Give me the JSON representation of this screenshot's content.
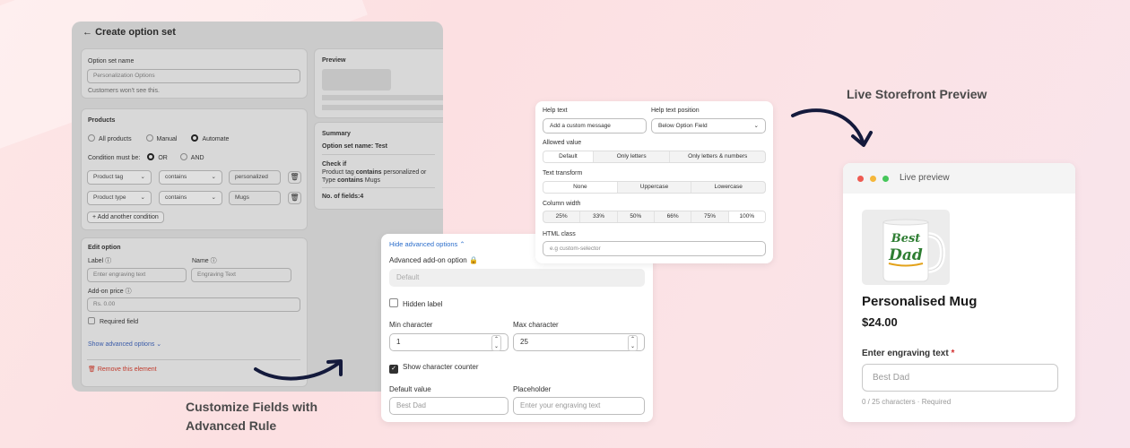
{
  "colors": {
    "accent_link": "#2c6ecb",
    "danger": "#c0392b",
    "heading": "#4a4a4a",
    "arrow": "#141a3c"
  },
  "admin": {
    "title": "Create option set",
    "option_set_name_label": "Option set name",
    "option_set_name_value": "Personalization Options",
    "option_set_name_help": "Customers won't see this.",
    "products": {
      "heading": "Products",
      "scope": [
        "All products",
        "Manual",
        "Automate"
      ],
      "condition_label": "Condition must be:",
      "condition_or": "OR",
      "condition_and": "AND",
      "rules": [
        {
          "field": "Product tag",
          "op": "contains",
          "value": "personalized"
        },
        {
          "field": "Product type",
          "op": "contains",
          "value": "Mugs"
        }
      ],
      "add_condition": "Add another condition"
    },
    "edit_option": {
      "heading": "Edit option",
      "label_label": "Label",
      "name_label": "Name",
      "label_placeholder": "Enter engraving text",
      "name_placeholder": "Engraving Text",
      "price_label": "Add-on price",
      "price_placeholder": "Rs. 0.00",
      "required_label": "Required field",
      "show_advanced": "Show advanced options",
      "remove": "Remove this element"
    },
    "preview_heading": "Preview",
    "summary": {
      "heading": "Summary",
      "name_label": "Option set name:",
      "name_value": "Test",
      "check_if": "Check if",
      "cond1_a": "Product tag",
      "cond1_b": "contains",
      "cond1_c": "personalized or",
      "cond2_a": "Type",
      "cond2_b": "contains",
      "cond2_c": "Mugs",
      "fields": "No. of fields:4"
    }
  },
  "advanced": {
    "hide_link": "Hide advanced options",
    "addon_label": "Advanced add-on option",
    "addon_value": "Default",
    "hidden_label": "Hidden label",
    "min_label": "Min character",
    "max_label": "Max character",
    "min_value": "1",
    "max_value": "25",
    "show_counter": "Show character counter",
    "default_label": "Default value",
    "placeholder_label": "Placeholder",
    "default_value": "Best Dad",
    "placeholder_value": "Enter your engraving text"
  },
  "helptext": {
    "help_label": "Help text",
    "position_label": "Help text position",
    "help_placeholder": "Add a custom message",
    "position_value": "Below Option Field",
    "allowed_label": "Allowed value",
    "allowed": [
      "Default",
      "Only letters",
      "Only letters & numbers"
    ],
    "transform_label": "Text transform",
    "transform": [
      "None",
      "Uppercase",
      "Lowercase"
    ],
    "width_label": "Column width",
    "widths": [
      "25%",
      "33%",
      "50%",
      "66%",
      "75%",
      "100%"
    ],
    "class_label": "HTML class",
    "class_placeholder": "e.g custom-selector"
  },
  "storefront": {
    "window_title": "Live preview",
    "mug_line1": "Best",
    "mug_line2": "Dad",
    "product_title": "Personalised Mug",
    "price": "$24.00",
    "field_label": "Enter engraving text",
    "field_placeholder": "Best Dad",
    "counter": "0 / 25 characters · Required"
  },
  "headings": {
    "storefront": "Live Storefront Preview",
    "customize_1": "Customize Fields with",
    "customize_2": "Advanced Rule"
  }
}
